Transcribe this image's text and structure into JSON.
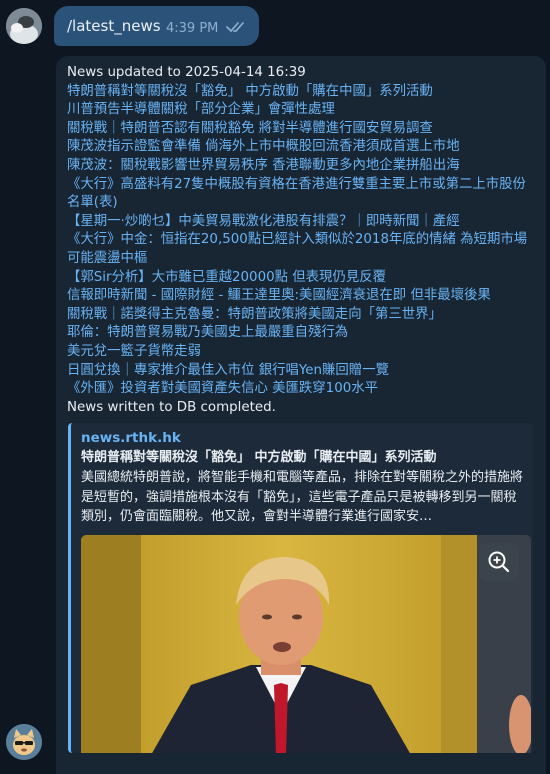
{
  "command": {
    "text": "/latest_news",
    "time": "4:39 PM"
  },
  "message": {
    "header": "News updated to 2025-04-14 16:39",
    "headlines": [
      "特朗普稱對等關稅沒「豁免」 中方啟動「購在中國」系列活動",
      "川普預告半導體關稅「部分企業」會彈性處理",
      "關稅戰｜特朗普否認有關稅豁免 將對半導體進行國安貿易調查",
      "陳茂波指示證監會準備 倘海外上市中概股回流香港須成首選上市地",
      "陳茂波：關稅戰影響世界貿易秩序 香港聯動更多內地企業拼船出海",
      "《大行》高盛料有27隻中概股有資格在香港進行雙重主要上市或第二上市股份名單(表)",
      "【星期一·炒啲乜】中美貿易戰激化港股有排震？｜即時新聞｜產經",
      "《大行》中金：恒指在20,500點已經計入類似於2018年底的情緒 為短期市場可能震盪中樞",
      "【郭Sir分析】大市雖已重越20000點 但表現仍見反覆",
      "信報即時新聞 - 國際財經 - 鱷王達里奧:美國經濟衰退在即 但非最壞後果",
      "關稅戰｜諾獎得主克魯曼：特朗普政策將美國走向「第三世界」",
      "耶倫：特朗普貿易戰乃美國史上最嚴重自殘行為",
      "美元兌一籃子貨幣走弱",
      "日圓兌換｜專家推介最佳入市位 銀行唱Yen賺回贈一覽",
      "《外匯》投資者對美國資產失信心 美匯跌穿100水平"
    ],
    "footer": "News written to DB completed.",
    "preview": {
      "site": "news.rthk.hk",
      "title": "特朗普稱對等關稅沒「豁免」 中方啟動「購在中國」系列活動",
      "description": "美國總統特朗普說，將智能手機和電腦等產品，排除在對等關稅之外的措施將是短暫的，強調措施根本沒有「豁免」，這些電子產品只是被轉移到另一關稅類別，仍會面臨關稅。他又說，會對半導體行業進行國家安…"
    }
  },
  "colors": {
    "background": "#0e1621",
    "outgoing_bubble": "#2b5278",
    "incoming_bubble": "#182533",
    "link": "#6ab3f3"
  },
  "icons": [
    "user-avatar",
    "double-check-icon",
    "bot-avatar",
    "zoom-icon"
  ]
}
